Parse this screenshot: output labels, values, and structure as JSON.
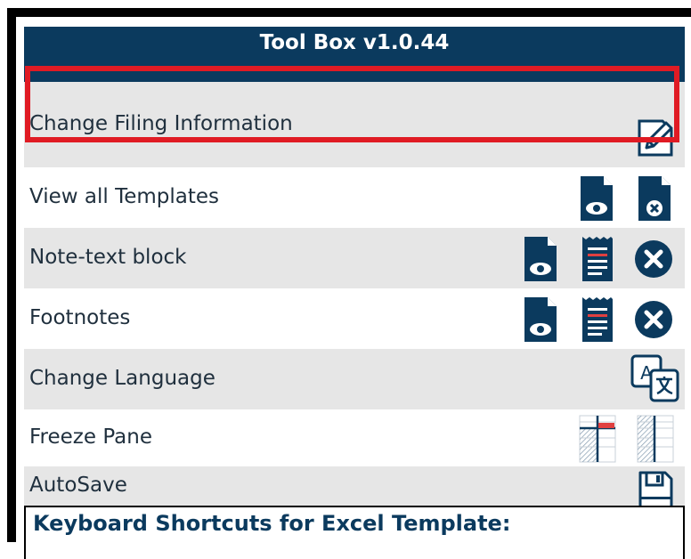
{
  "toolbox": {
    "title": "Tool Box v1.0.44",
    "rows": [
      {
        "label": "Change Filing Information",
        "icons": [
          "edit-icon"
        ]
      },
      {
        "label": "View all Templates",
        "icons": [
          "view-document-icon",
          "remove-document-icon"
        ]
      },
      {
        "label": "Note-text block",
        "icons": [
          "view-document-icon",
          "text-block-icon",
          "close-circle-icon"
        ]
      },
      {
        "label": "Footnotes",
        "icons": [
          "view-document-icon",
          "text-block-icon",
          "close-circle-icon"
        ]
      },
      {
        "label": "Change Language",
        "icons": [
          "translate-icon"
        ]
      },
      {
        "label": "Freeze Pane",
        "icons": [
          "freeze-pane-icon",
          "unfreeze-pane-icon"
        ]
      },
      {
        "label": "AutoSave",
        "icons": [
          "save-icon"
        ]
      }
    ],
    "shortcuts_heading": "Keyboard Shortcuts for Excel Template:"
  },
  "colors": {
    "navy": "#0b3a5e",
    "row_gray": "#e6e6e6",
    "highlight": "#e01b24",
    "accent_red": "#e04040"
  }
}
